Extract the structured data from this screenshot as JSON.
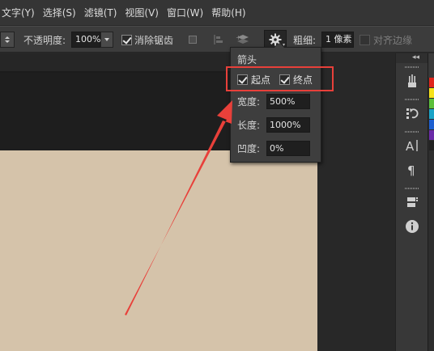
{
  "menu": {
    "items": [
      "文字(Y)",
      "选择(S)",
      "滤镜(T)",
      "视图(V)",
      "窗口(W)",
      "帮助(H)"
    ]
  },
  "options_bar": {
    "opacity_label": "不透明度:",
    "opacity_value": "100%",
    "antialias_label": "消除锯齿",
    "antialias_checked": true,
    "weight_label": "粗细:",
    "weight_value": "1 像素",
    "align_edges_label": "对齐边缘",
    "align_edges_checked": false
  },
  "arrow_panel": {
    "title": "箭头",
    "start_label": "起点",
    "start_checked": true,
    "end_label": "终点",
    "end_checked": true,
    "width_label": "宽度:",
    "width_value": "500%",
    "length_label": "长度:",
    "length_value": "1000%",
    "concavity_label": "凹度:",
    "concavity_value": "0%"
  },
  "dock": {
    "icons": [
      "brush-preset-icon",
      "history-icon",
      "character-icon",
      "paragraph-icon",
      "layer-comps-icon",
      "info-icon"
    ]
  },
  "colors": {
    "canvas": "#d5c3aa",
    "annotation_red": "#e8403a",
    "swatches": [
      "#e0241b",
      "#f6e21a",
      "#5bbf3a",
      "#1aa3c7",
      "#1d5fd0",
      "#6a2aa8",
      "#222222"
    ]
  }
}
